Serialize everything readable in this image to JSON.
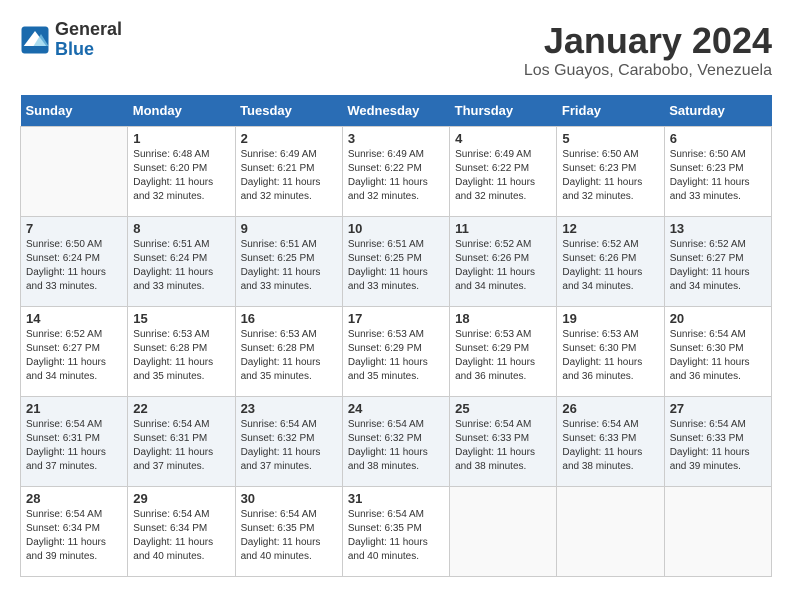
{
  "logo": {
    "general": "General",
    "blue": "Blue"
  },
  "title": "January 2024",
  "subtitle": "Los Guayos, Carabobo, Venezuela",
  "days_of_week": [
    "Sunday",
    "Monday",
    "Tuesday",
    "Wednesday",
    "Thursday",
    "Friday",
    "Saturday"
  ],
  "weeks": [
    [
      {
        "day": "",
        "info": ""
      },
      {
        "day": "1",
        "info": "Sunrise: 6:48 AM\nSunset: 6:20 PM\nDaylight: 11 hours\nand 32 minutes."
      },
      {
        "day": "2",
        "info": "Sunrise: 6:49 AM\nSunset: 6:21 PM\nDaylight: 11 hours\nand 32 minutes."
      },
      {
        "day": "3",
        "info": "Sunrise: 6:49 AM\nSunset: 6:22 PM\nDaylight: 11 hours\nand 32 minutes."
      },
      {
        "day": "4",
        "info": "Sunrise: 6:49 AM\nSunset: 6:22 PM\nDaylight: 11 hours\nand 32 minutes."
      },
      {
        "day": "5",
        "info": "Sunrise: 6:50 AM\nSunset: 6:23 PM\nDaylight: 11 hours\nand 32 minutes."
      },
      {
        "day": "6",
        "info": "Sunrise: 6:50 AM\nSunset: 6:23 PM\nDaylight: 11 hours\nand 33 minutes."
      }
    ],
    [
      {
        "day": "7",
        "info": "Sunrise: 6:50 AM\nSunset: 6:24 PM\nDaylight: 11 hours\nand 33 minutes."
      },
      {
        "day": "8",
        "info": "Sunrise: 6:51 AM\nSunset: 6:24 PM\nDaylight: 11 hours\nand 33 minutes."
      },
      {
        "day": "9",
        "info": "Sunrise: 6:51 AM\nSunset: 6:25 PM\nDaylight: 11 hours\nand 33 minutes."
      },
      {
        "day": "10",
        "info": "Sunrise: 6:51 AM\nSunset: 6:25 PM\nDaylight: 11 hours\nand 33 minutes."
      },
      {
        "day": "11",
        "info": "Sunrise: 6:52 AM\nSunset: 6:26 PM\nDaylight: 11 hours\nand 34 minutes."
      },
      {
        "day": "12",
        "info": "Sunrise: 6:52 AM\nSunset: 6:26 PM\nDaylight: 11 hours\nand 34 minutes."
      },
      {
        "day": "13",
        "info": "Sunrise: 6:52 AM\nSunset: 6:27 PM\nDaylight: 11 hours\nand 34 minutes."
      }
    ],
    [
      {
        "day": "14",
        "info": "Sunrise: 6:52 AM\nSunset: 6:27 PM\nDaylight: 11 hours\nand 34 minutes."
      },
      {
        "day": "15",
        "info": "Sunrise: 6:53 AM\nSunset: 6:28 PM\nDaylight: 11 hours\nand 35 minutes."
      },
      {
        "day": "16",
        "info": "Sunrise: 6:53 AM\nSunset: 6:28 PM\nDaylight: 11 hours\nand 35 minutes."
      },
      {
        "day": "17",
        "info": "Sunrise: 6:53 AM\nSunset: 6:29 PM\nDaylight: 11 hours\nand 35 minutes."
      },
      {
        "day": "18",
        "info": "Sunrise: 6:53 AM\nSunset: 6:29 PM\nDaylight: 11 hours\nand 36 minutes."
      },
      {
        "day": "19",
        "info": "Sunrise: 6:53 AM\nSunset: 6:30 PM\nDaylight: 11 hours\nand 36 minutes."
      },
      {
        "day": "20",
        "info": "Sunrise: 6:54 AM\nSunset: 6:30 PM\nDaylight: 11 hours\nand 36 minutes."
      }
    ],
    [
      {
        "day": "21",
        "info": "Sunrise: 6:54 AM\nSunset: 6:31 PM\nDaylight: 11 hours\nand 37 minutes."
      },
      {
        "day": "22",
        "info": "Sunrise: 6:54 AM\nSunset: 6:31 PM\nDaylight: 11 hours\nand 37 minutes."
      },
      {
        "day": "23",
        "info": "Sunrise: 6:54 AM\nSunset: 6:32 PM\nDaylight: 11 hours\nand 37 minutes."
      },
      {
        "day": "24",
        "info": "Sunrise: 6:54 AM\nSunset: 6:32 PM\nDaylight: 11 hours\nand 38 minutes."
      },
      {
        "day": "25",
        "info": "Sunrise: 6:54 AM\nSunset: 6:33 PM\nDaylight: 11 hours\nand 38 minutes."
      },
      {
        "day": "26",
        "info": "Sunrise: 6:54 AM\nSunset: 6:33 PM\nDaylight: 11 hours\nand 38 minutes."
      },
      {
        "day": "27",
        "info": "Sunrise: 6:54 AM\nSunset: 6:33 PM\nDaylight: 11 hours\nand 39 minutes."
      }
    ],
    [
      {
        "day": "28",
        "info": "Sunrise: 6:54 AM\nSunset: 6:34 PM\nDaylight: 11 hours\nand 39 minutes."
      },
      {
        "day": "29",
        "info": "Sunrise: 6:54 AM\nSunset: 6:34 PM\nDaylight: 11 hours\nand 40 minutes."
      },
      {
        "day": "30",
        "info": "Sunrise: 6:54 AM\nSunset: 6:35 PM\nDaylight: 11 hours\nand 40 minutes."
      },
      {
        "day": "31",
        "info": "Sunrise: 6:54 AM\nSunset: 6:35 PM\nDaylight: 11 hours\nand 40 minutes."
      },
      {
        "day": "",
        "info": ""
      },
      {
        "day": "",
        "info": ""
      },
      {
        "day": "",
        "info": ""
      }
    ]
  ]
}
